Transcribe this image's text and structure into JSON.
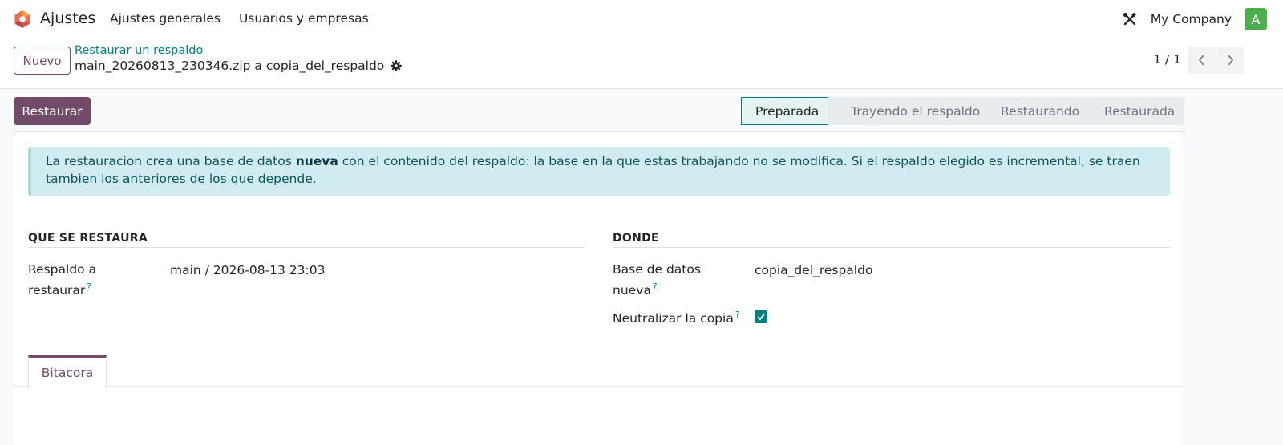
{
  "navbar": {
    "app_name": "Ajustes",
    "menu": [
      "Ajustes generales",
      "Usuarios y empresas"
    ],
    "company": "My Company",
    "avatar_initial": "A",
    "avatar_color": "#4cae4c"
  },
  "control_panel": {
    "new_button": "Nuevo",
    "breadcrumb": "Restaurar un respaldo",
    "record_title": "main_20260813_230346.zip a copia_del_respaldo",
    "pager": "1 / 1"
  },
  "actions": {
    "restore_button": "Restaurar"
  },
  "statusbar": {
    "stages": [
      "Preparada",
      "Trayendo el respaldo",
      "Restaurando",
      "Restaurada"
    ],
    "active": "Preparada"
  },
  "alert": {
    "text_before": "La restauracion crea una base de datos ",
    "text_bold": "nueva",
    "text_after": " con el contenido del respaldo: la base en la que estas trabajando no se modifica. Si el respaldo elegido es incremental, se traen tambien los anteriores de los que depende."
  },
  "groups": {
    "left": {
      "title": "QUE SE RESTAURA",
      "fields": [
        {
          "label": "Respaldo a restaurar",
          "help": "?",
          "value": "main / 2026-08-13 23:03"
        }
      ]
    },
    "right": {
      "title": "DONDE",
      "fields": [
        {
          "label": "Base de datos nueva",
          "help": "?",
          "value": "copia_del_respaldo"
        },
        {
          "label": "Neutralizar la copia",
          "help": "?",
          "checked": true
        }
      ]
    }
  },
  "tabs": [
    "Bitacora"
  ],
  "colors": {
    "brand": "#714b67",
    "accent": "#017e84",
    "alert_bg": "#d1ecf1"
  },
  "icons": {
    "app_logo": "odoo-logo-icon",
    "tools": "tools-icon",
    "gear": "gear-icon",
    "prev": "chevron-left-icon",
    "next": "chevron-right-icon",
    "check": "check-icon"
  }
}
